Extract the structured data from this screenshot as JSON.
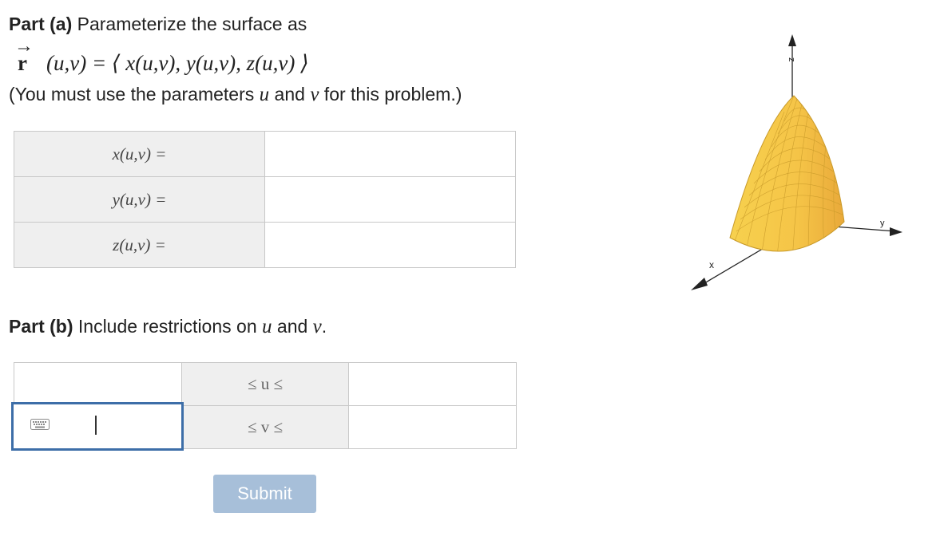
{
  "part_a": {
    "heading_bold": "Part (a)",
    "heading_text": " Parameterize the surface as",
    "vector_arrow": "→",
    "vector_name": "r",
    "vector_expression": " (u,v) = ⟨ x(u,v), y(u,v), z(u,v) ⟩",
    "instruction_pre": "(You must use the parameters ",
    "instruction_u": "u",
    "instruction_mid": " and ",
    "instruction_v": "v",
    "instruction_post": " for this problem.)",
    "rows": [
      {
        "label": "x(u,v) =",
        "value": ""
      },
      {
        "label": "y(u,v) =",
        "value": ""
      },
      {
        "label": "z(u,v) =",
        "value": ""
      }
    ]
  },
  "part_b": {
    "heading_bold": "Part (b)",
    "heading_text": " Include restrictions on ",
    "heading_u": "u",
    "heading_and": " and ",
    "heading_v": "v",
    "heading_end": ".",
    "rows": [
      {
        "middle": "≤ u ≤",
        "lower": "",
        "upper": ""
      },
      {
        "middle": "≤ v ≤",
        "lower": "",
        "upper": ""
      }
    ]
  },
  "submit_label": "Submit",
  "figure": {
    "axis_z": "z",
    "axis_y": "y",
    "axis_x": "x",
    "surface_color": "#f5c84a",
    "mesh_color": "#c89a2a"
  },
  "colors": {
    "focus_border": "#3d6ea8",
    "submit_bg": "#a7bfd9",
    "label_bg": "#efefef"
  }
}
